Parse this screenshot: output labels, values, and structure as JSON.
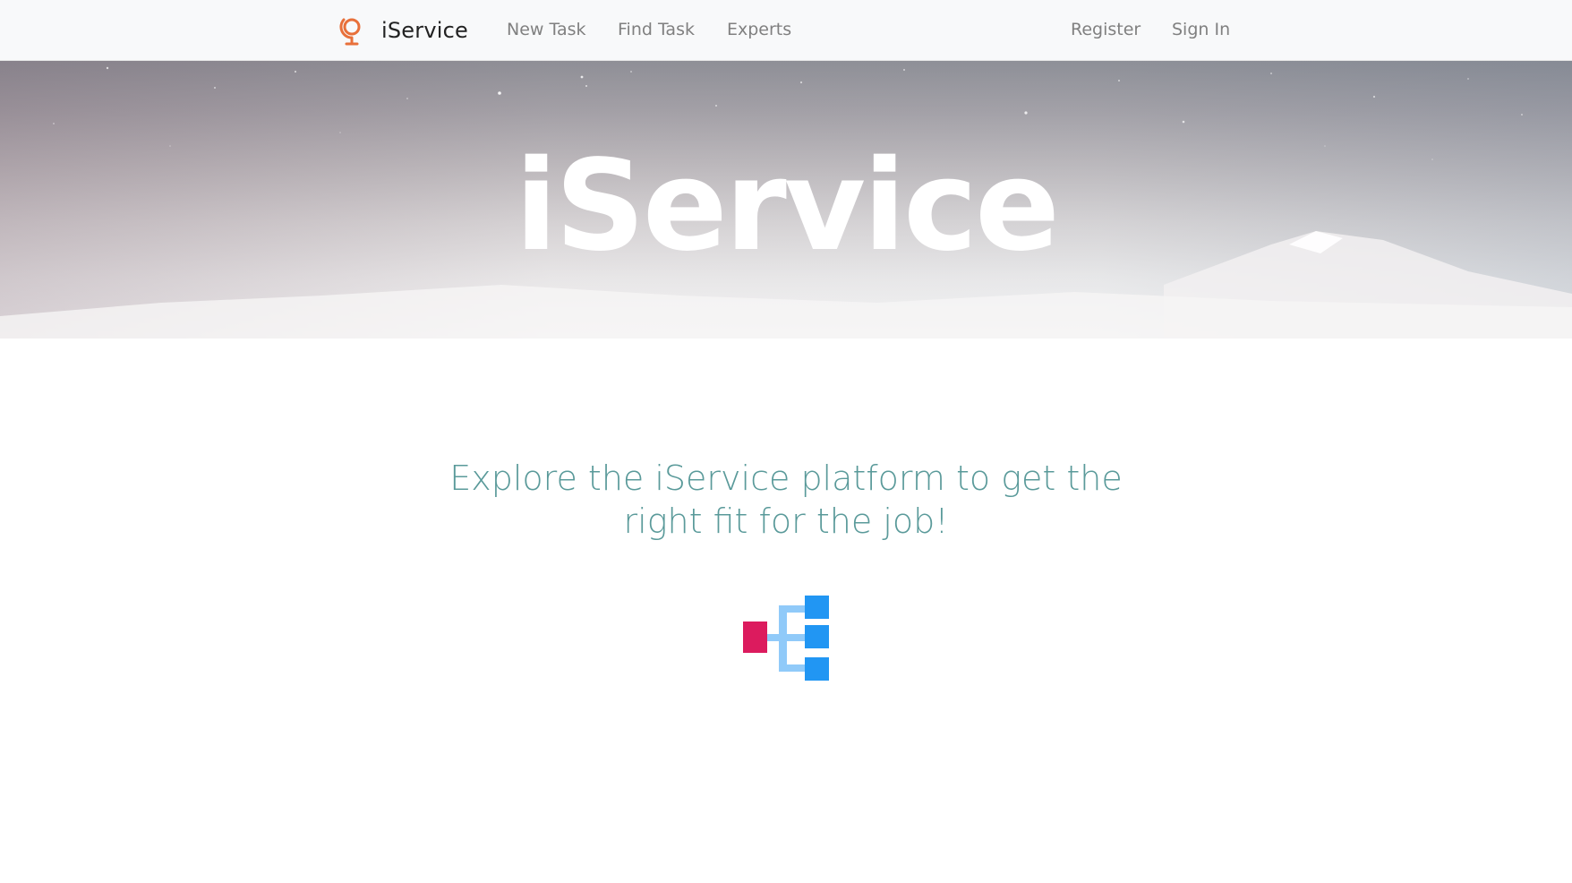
{
  "navbar": {
    "brand": {
      "icon": "globe-stand-icon",
      "name": "iService"
    },
    "links": {
      "new_task": "New Task",
      "find_task": "Find Task",
      "experts": "Experts",
      "register": "Register",
      "sign_in": "Sign In"
    }
  },
  "hero": {
    "title": "iService"
  },
  "main": {
    "tagline": "Explore the iService platform to get the right fit for the job!",
    "illustration_icon": "hierarchy-icon"
  },
  "colors": {
    "brand_icon": "#e8703a",
    "tagline": "#5a9a9a",
    "hierarchy_root": "#dc1b5e",
    "hierarchy_children": "#2196f3",
    "hierarchy_connectors": "#90caf9"
  }
}
